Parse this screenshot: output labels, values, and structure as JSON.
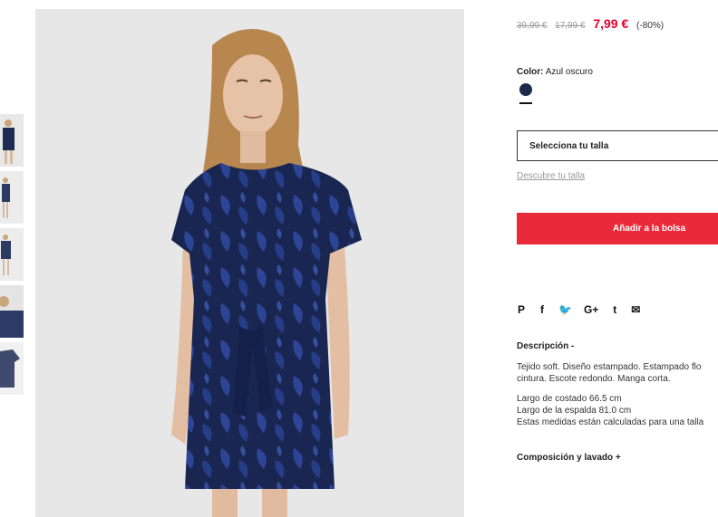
{
  "prices": {
    "original": "39,99 €",
    "previous": "17,99 €",
    "current": "7,99 €",
    "discount": "(-80%)"
  },
  "color": {
    "label": "Color:",
    "value": "Azul oscuro",
    "swatch_hex": "#1d2a4a"
  },
  "size": {
    "select_label": "Selecciona tu talla",
    "discover_link": "Descubre tu talla"
  },
  "cart": {
    "add_label": "Añadir a la bolsa",
    "accent_hex": "#e92a3a"
  },
  "share": {
    "icons": [
      "pinterest-icon",
      "facebook-icon",
      "twitter-icon",
      "google-plus-icon",
      "tumblr-icon",
      "email-icon"
    ],
    "glyphs": [
      "𝓅",
      "f",
      "🐦",
      "G+",
      "t",
      "✉"
    ]
  },
  "description": {
    "title": "Descripción -",
    "line1": "Tejido soft. Diseño estampado. Estampado flo",
    "line2": "cintura. Escote redondo. Manga corta.",
    "measure1": "Largo de costado 66.5 cm",
    "measure2": "Largo de la espalda 81.0 cm",
    "measure3": "Estas medidas están calculadas para una talla"
  },
  "composition": {
    "title": "Composición y lavado +"
  }
}
